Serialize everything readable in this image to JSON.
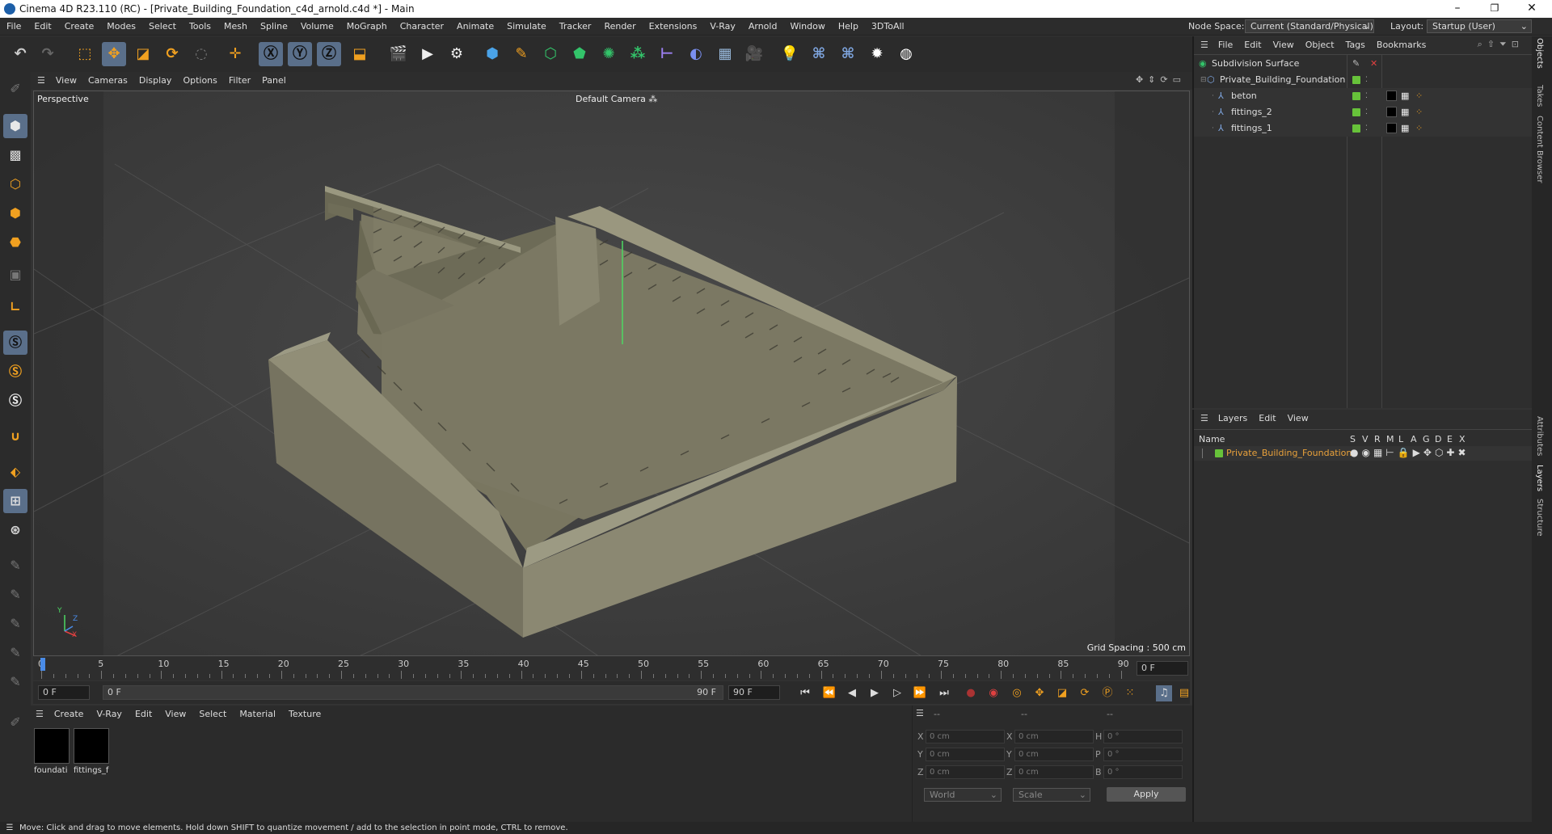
{
  "window": {
    "title": "Cinema 4D R23.110 (RC) - [Private_Building_Foundation_c4d_arnold.c4d *] - Main",
    "minimize": "–",
    "maximize": "❐",
    "close": "✕"
  },
  "menubar": {
    "items": [
      "File",
      "Edit",
      "Create",
      "Modes",
      "Select",
      "Tools",
      "Mesh",
      "Spline",
      "Volume",
      "MoGraph",
      "Character",
      "Animate",
      "Simulate",
      "Tracker",
      "Render",
      "Extensions",
      "V-Ray",
      "Arnold",
      "Window",
      "Help",
      "3DToAll"
    ],
    "node_space_label": "Node Space:",
    "node_space_value": "Current (Standard/Physical)",
    "layout_label": "Layout:",
    "layout_value": "Startup (User)"
  },
  "viewport": {
    "menu": [
      "View",
      "Cameras",
      "Display",
      "Options",
      "Filter",
      "Panel"
    ],
    "name": "Perspective",
    "camera": "Default Camera",
    "grid_spacing": "Grid Spacing : 500 cm",
    "axis_y": "Y",
    "axis_z": "Z",
    "axis_x": "X"
  },
  "timeline": {
    "ticks": [
      "0",
      "5",
      "10",
      "15",
      "20",
      "25",
      "30",
      "35",
      "40",
      "45",
      "50",
      "55",
      "60",
      "65",
      "70",
      "75",
      "80",
      "85",
      "90"
    ],
    "current_frame": "0 F"
  },
  "transport": {
    "start": "0 F",
    "range_start": "0 F",
    "range_end": "90 F",
    "end": "90 F"
  },
  "materials": {
    "menu": [
      "Create",
      "V-Ray",
      "Edit",
      "View",
      "Select",
      "Material",
      "Texture"
    ],
    "items": [
      {
        "label": "foundati"
      },
      {
        "label": "fittings_f"
      }
    ]
  },
  "attributes": {
    "header": [
      "--",
      "--",
      "--"
    ],
    "rows": [
      {
        "a": "X",
        "av": "0 cm",
        "b": "X",
        "bv": "0 cm",
        "c": "H",
        "cv": "0 °"
      },
      {
        "a": "Y",
        "av": "0 cm",
        "b": "Y",
        "bv": "0 cm",
        "c": "P",
        "cv": "0 °"
      },
      {
        "a": "Z",
        "av": "0 cm",
        "b": "Z",
        "bv": "0 cm",
        "c": "B",
        "cv": "0 °"
      }
    ],
    "coord_system": "World",
    "mode": "Scale",
    "apply": "Apply"
  },
  "objects": {
    "menu": [
      "File",
      "Edit",
      "View",
      "Object",
      "Tags",
      "Bookmarks"
    ],
    "rows": [
      {
        "name": "Subdivision Surface"
      },
      {
        "name": "Private_Building_Foundation"
      },
      {
        "name": "beton"
      },
      {
        "name": "fittings_2"
      },
      {
        "name": "fittings_1"
      }
    ]
  },
  "layers": {
    "menu": [
      "Layers",
      "Edit",
      "View"
    ],
    "header_name": "Name",
    "header_cols": [
      "S",
      "V",
      "R",
      "M",
      "L",
      "A",
      "G",
      "D",
      "E",
      "X"
    ],
    "row": "Private_Building_Foundation",
    "row_color": "#e9a13b"
  },
  "sidetabs": [
    "Objects",
    "Takes",
    "Content Browser",
    "Attributes",
    "Layers",
    "Structure"
  ],
  "status": "Move: Click and drag to move elements. Hold down SHIFT to quantize movement / add to the selection in point mode, CTRL to remove.",
  "colors": {
    "accent": "#5a6f8a",
    "green": "#67c23a",
    "orange": "#e9a13b"
  }
}
